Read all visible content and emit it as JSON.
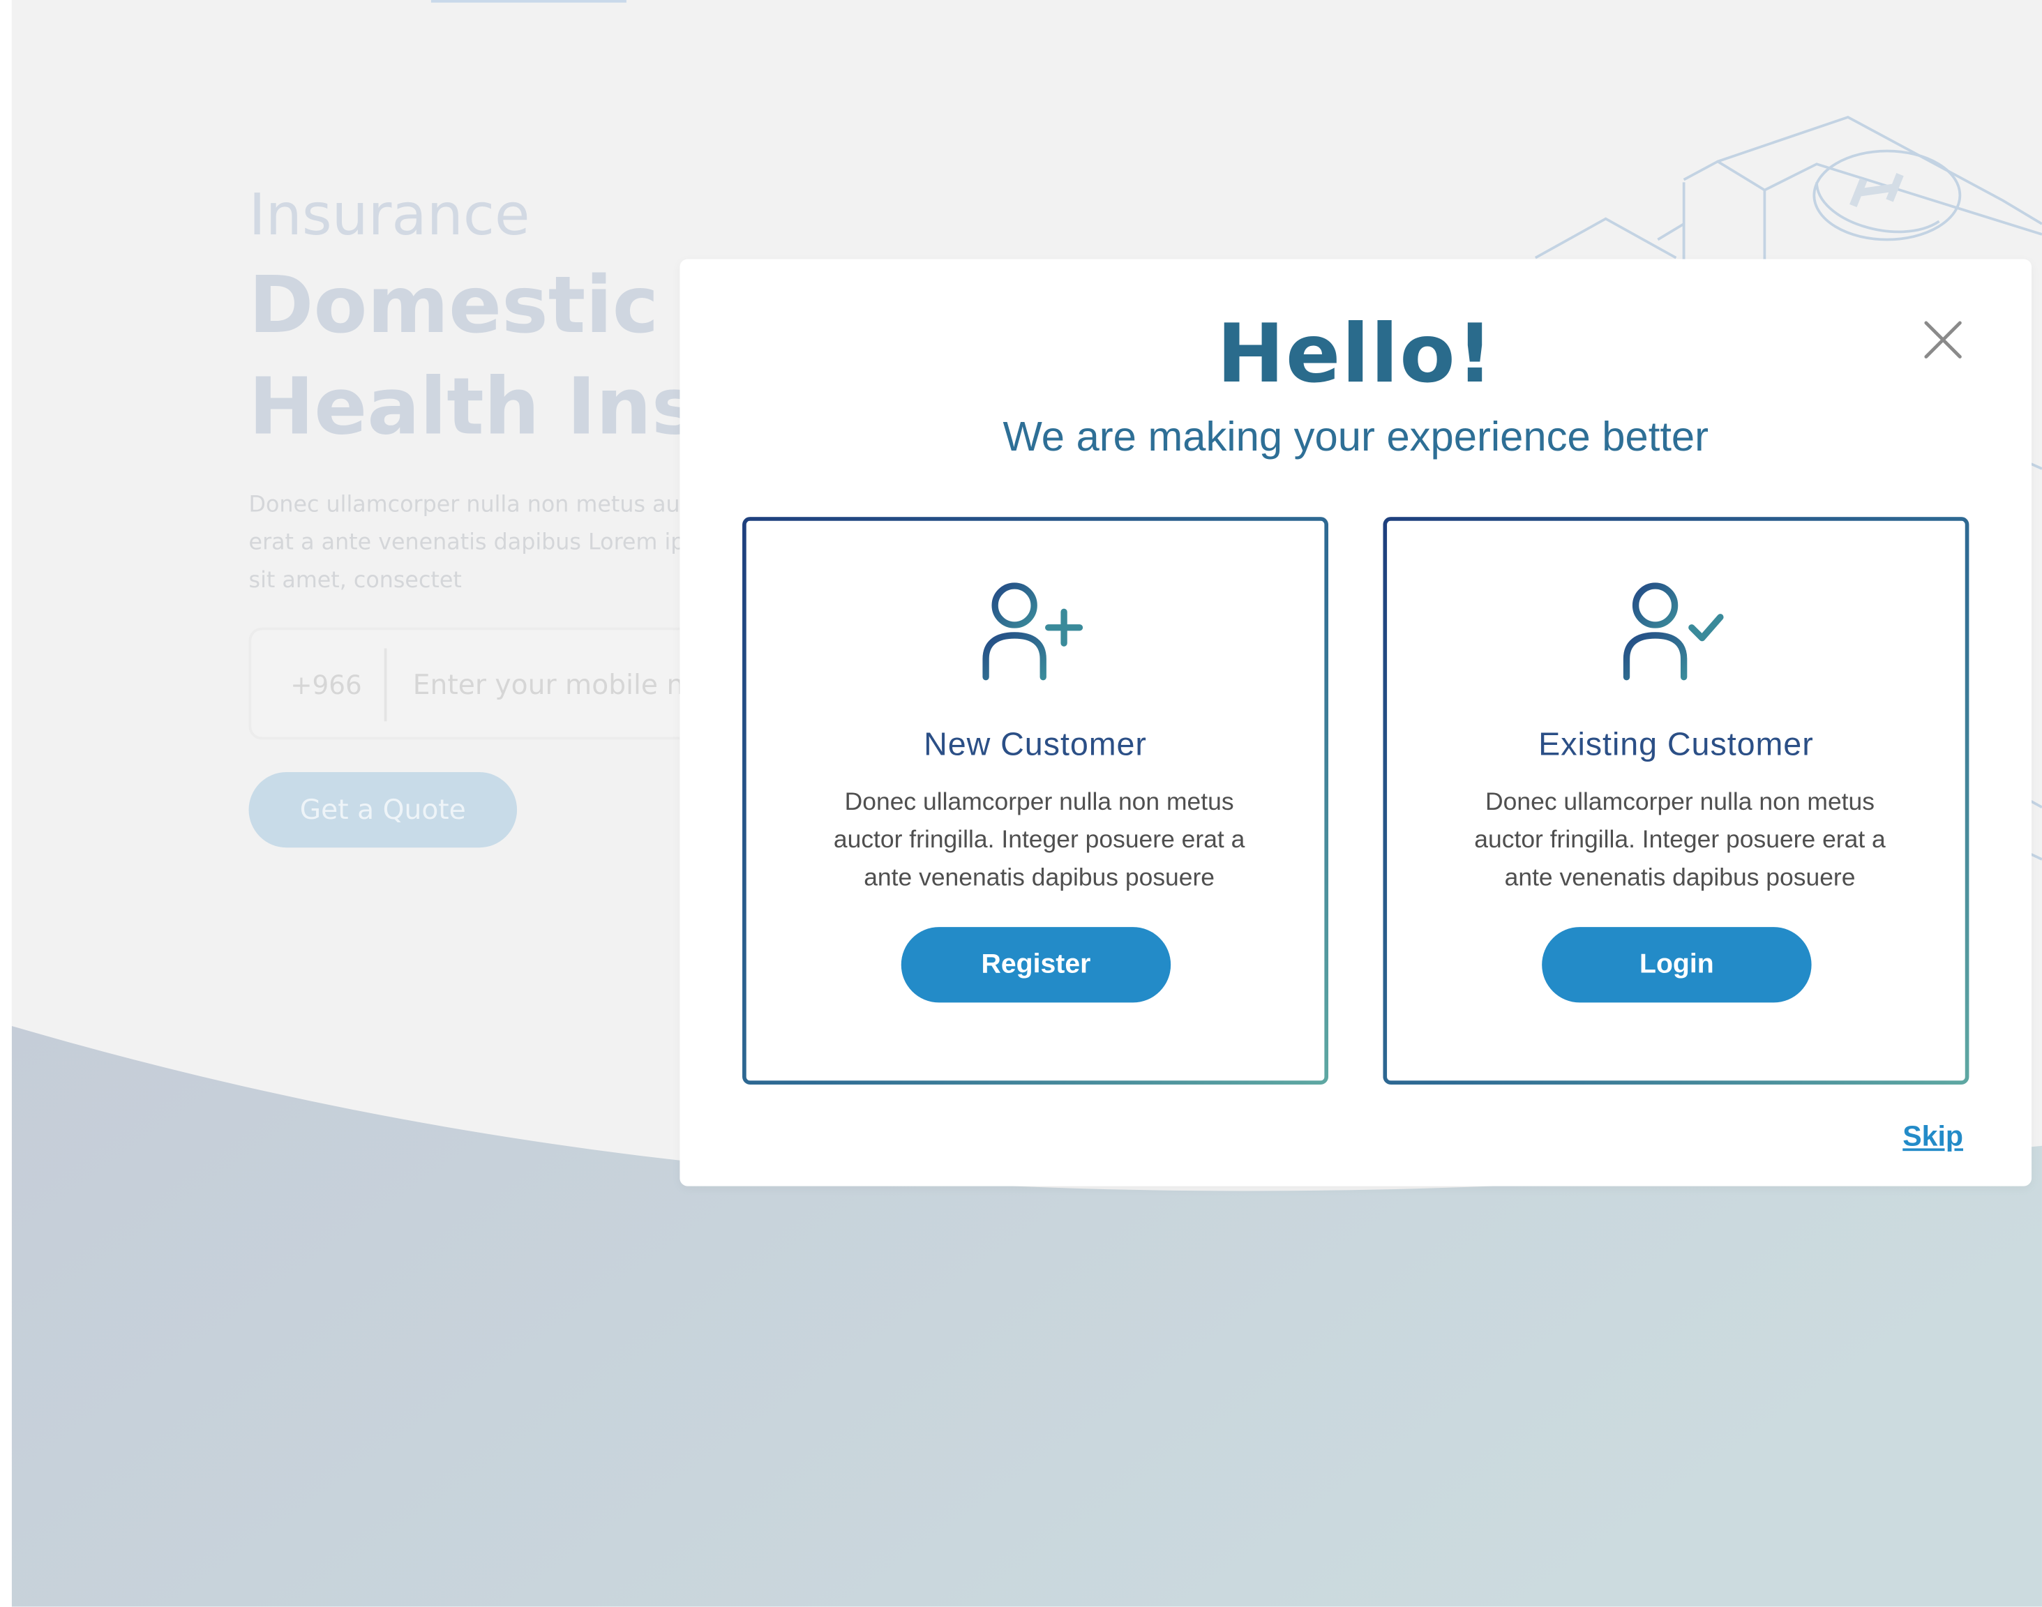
{
  "background": {
    "eyebrow": "Insurance",
    "title_line1": "Domestic H",
    "title_line2": "Health Insu",
    "description": "Donec ullamcorper nulla non metus au posuere erat a ante venenatis dapibus Lorem ipsum dolor sit amet, consectet",
    "phone_prefix": "+966",
    "phone_placeholder": "Enter your mobile nu",
    "quote_button": "Get a Quote"
  },
  "modal": {
    "title": "Hello!",
    "subtitle": "We are making your experience better",
    "close_icon": "close-icon",
    "skip_label": "Skip",
    "cards": [
      {
        "icon": "user-add-icon",
        "heading": "New Customer",
        "text": "Donec ullamcorper nulla non metus auctor fringilla. Integer posuere erat a ante venenatis dapibus posuere",
        "button": "Register"
      },
      {
        "icon": "user-check-icon",
        "heading": "Existing Customer",
        "text": "Donec ullamcorper nulla non metus auctor fringilla. Integer posuere erat a ante venenatis dapibus posuere",
        "button": "Login"
      }
    ]
  },
  "colors": {
    "primary_button": "#238bc8",
    "title_teal": "#2a6b8c",
    "heading_navy": "#2b4f86",
    "card_border_start": "#1e3f7d",
    "card_border_end": "#5fa8a2"
  }
}
